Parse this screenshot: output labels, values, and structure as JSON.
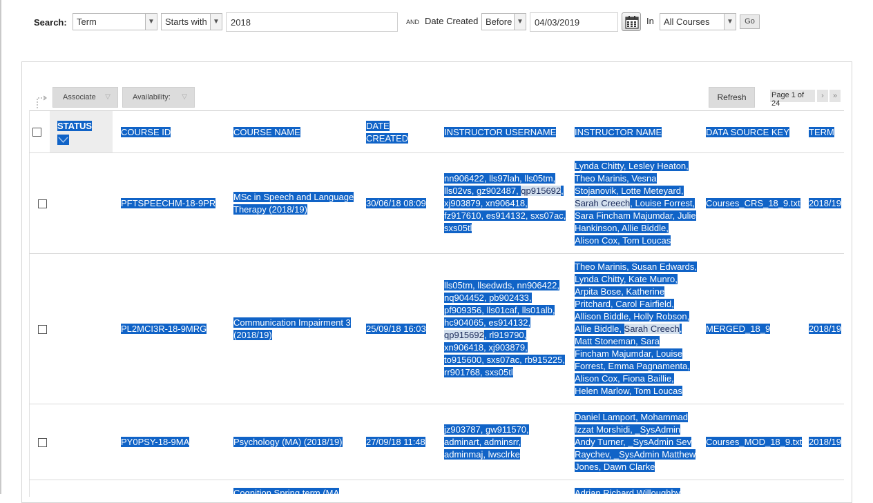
{
  "search": {
    "label": "Search:",
    "field": "Term",
    "operator": "Starts with",
    "value": "2018",
    "and_label": "AND",
    "date_label": "Date Created",
    "date_operator": "Before",
    "date_value": "04/03/2019",
    "in_label": "In",
    "scope": "All Courses",
    "go_label": "Go"
  },
  "toolbar": {
    "associate_label": "Associate",
    "availability_label": "Availability:",
    "refresh_label": "Refresh",
    "page_info": "Page 1 of 24"
  },
  "table": {
    "columns": {
      "status": "STATUS",
      "course_id": "COURSE ID",
      "course_name": "COURSE NAME",
      "date_created_1": "DATE",
      "date_created_2": "CREATED",
      "instructor_username": "INSTRUCTOR USERNAME",
      "instructor_name": "INSTRUCTOR NAME",
      "data_source_key": "DATA SOURCE KEY",
      "term": "TERM"
    },
    "rows": [
      {
        "course_id": "PFTSPEECHM-18-9PR",
        "course_name": [
          "MSc in Speech and Language",
          "Therapy (2018/19)"
        ],
        "date_created": "30/06/18 08:09",
        "usernames": [
          [
            "nn906422, lls97lah, lls05tm,"
          ],
          [
            "lls02vs, gz902487, ",
            {
              "hl": "qp915692"
            },
            ","
          ],
          [
            "xj903879, xn906418,"
          ],
          [
            "fz917610, es914132, sxs07ac,"
          ],
          [
            "sxs05tl"
          ]
        ],
        "names": [
          [
            "Lynda Chitty, Lesley Heaton,"
          ],
          [
            "Theo Marinis, Vesna"
          ],
          [
            "Stojanovik, Lotte Meteyard,"
          ],
          [
            {
              "hl": "Sarah Creech"
            },
            ", Louise Forrest,"
          ],
          [
            "Sara Fincham Majumdar, Julie"
          ],
          [
            "Hankinson, Allie Biddle,"
          ],
          [
            "Alison Cox, Tom Loucas"
          ]
        ],
        "data_source_key": "Courses_CRS_18_9.txt",
        "term": "2018/19"
      },
      {
        "course_id": "PL2MCI3R-18-9MRG",
        "course_name": [
          "Communication Impairment 3",
          "(2018/19)"
        ],
        "date_created": "25/09/18 16:03",
        "usernames": [
          [
            "lls05tm, llsedwds, nn906422,"
          ],
          [
            "nq904452, pb902433,"
          ],
          [
            "pf909356, lls01caf, lls01alb,"
          ],
          [
            "hc904065, es914132,"
          ],
          [
            {
              "hl": "qp915692"
            },
            ", rl919790,"
          ],
          [
            "xn906418, xj903879,"
          ],
          [
            "to915600, sxs07ac, rb915225,"
          ],
          [
            "rr901768, sxs05tl"
          ]
        ],
        "names": [
          [
            "Theo Marinis, Susan Edwards,"
          ],
          [
            "Lynda Chitty, Kate Munro,"
          ],
          [
            "Arpita Bose, Katherine"
          ],
          [
            "Pritchard, Carol Fairfield,"
          ],
          [
            "Allison Biddle, Holly Robson,"
          ],
          [
            "Allie Biddle, ",
            {
              "hl": "Sarah Creech"
            },
            ","
          ],
          [
            "Matt Stoneman, Sara"
          ],
          [
            "Fincham Majumdar, Louise"
          ],
          [
            "Forrest, Emma Pagnamenta,"
          ],
          [
            "Alison Cox, Fiona Baillie,"
          ],
          [
            "Helen Marlow, Tom Loucas"
          ]
        ],
        "data_source_key": "MERGED_18_9",
        "term": "2018/19"
      },
      {
        "course_id": "PY0PSY-18-9MA",
        "course_name": [
          "Psychology (MA) (2018/19)"
        ],
        "date_created": "27/09/18 11:48",
        "usernames": [
          [
            "jz903787, gw911570,"
          ],
          [
            "adminart, adminsrr,"
          ],
          [
            "adminmaj, lwsclrke"
          ]
        ],
        "names": [
          [
            "Daniel Lamport, Mohammad"
          ],
          [
            "Izzat Morshidi, _SysAdmin"
          ],
          [
            "Andy Turner, _SysAdmin Sev"
          ],
          [
            "Raychev, _SysAdmin Matthew"
          ],
          [
            "Jones, Dawn Clarke"
          ]
        ],
        "data_source_key": "Courses_MOD_18_9.txt",
        "term": "2018/19"
      }
    ],
    "partial_row": {
      "course_name": "Cognition Spring term (MA",
      "instructor_name": "Adrian Richard Willoughby"
    }
  }
}
